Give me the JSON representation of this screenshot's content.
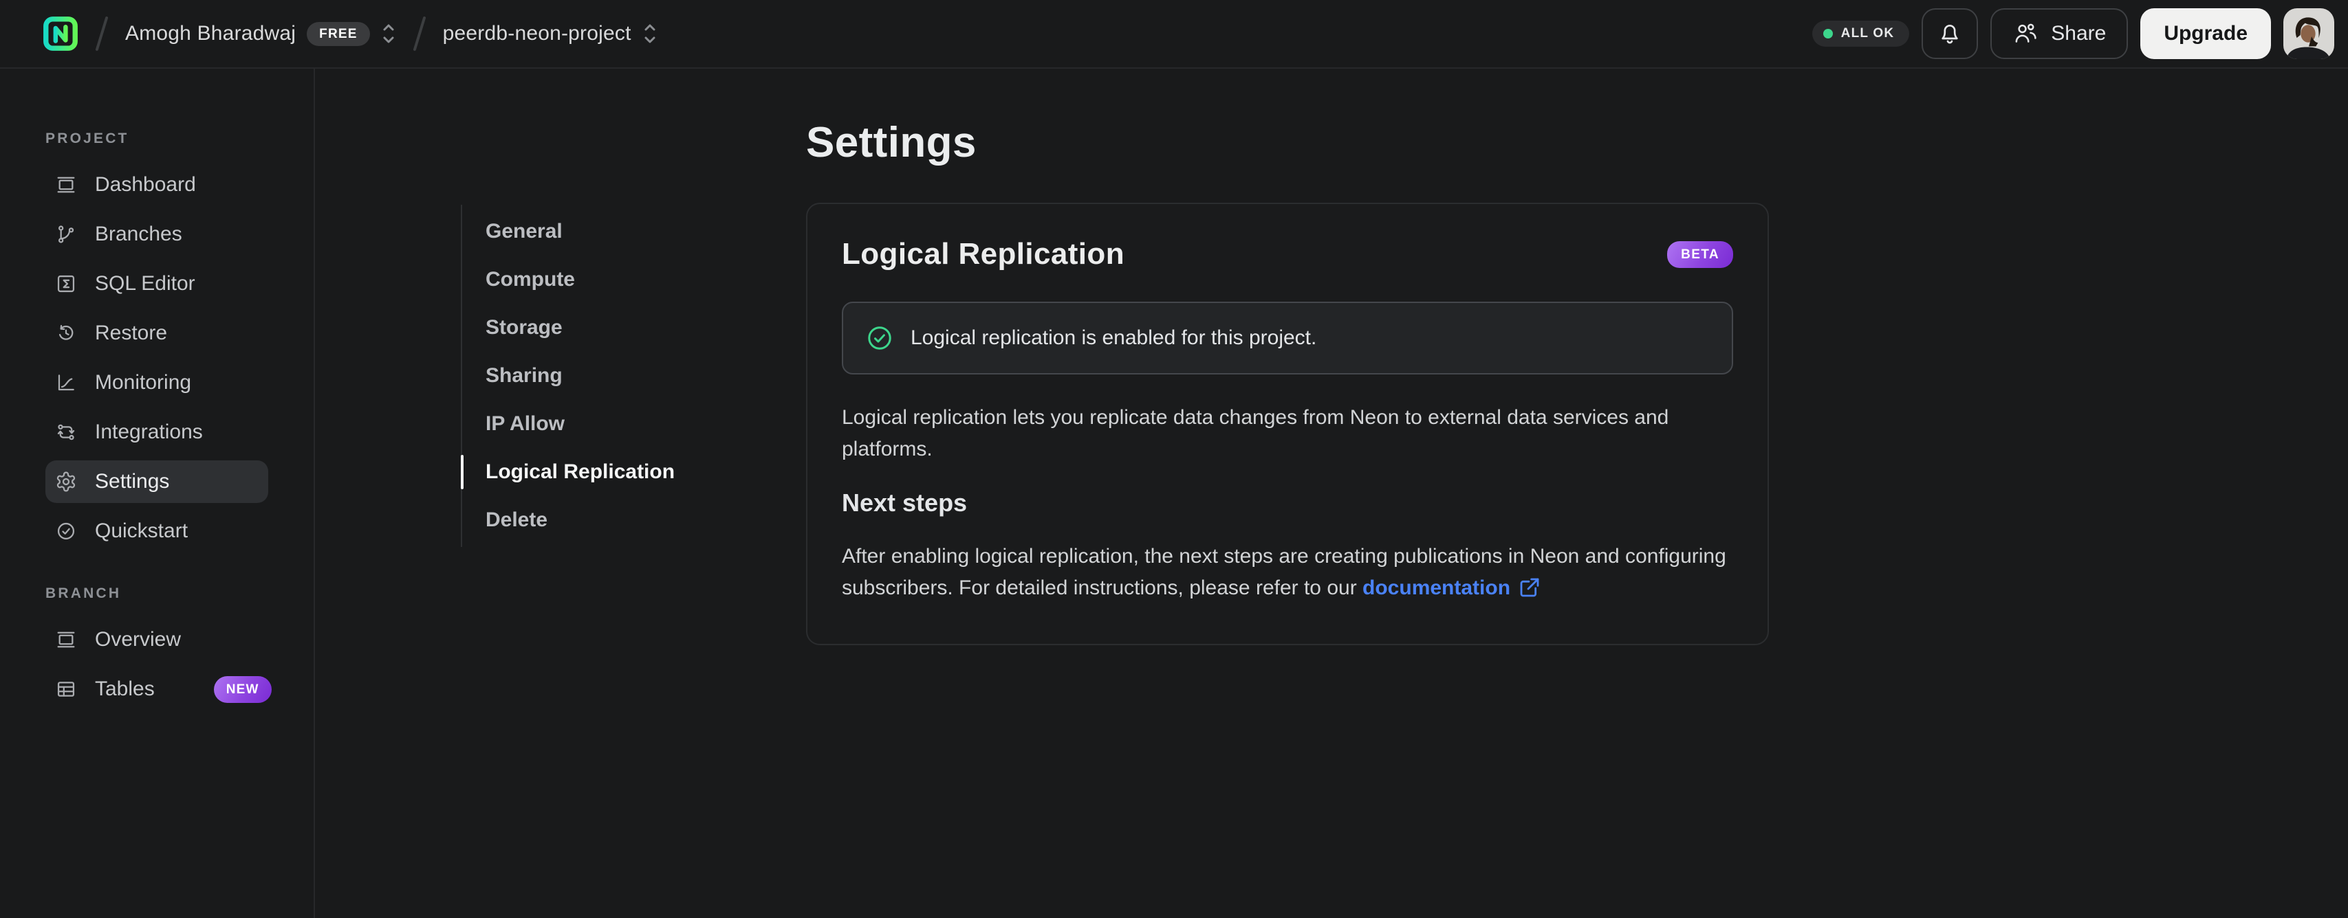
{
  "topbar": {
    "logo_icon": "neon-logo-icon",
    "org_name": "Amogh Bharadwaj",
    "plan_badge": "FREE",
    "project_name": "peerdb-neon-project",
    "status_label": "ALL OK",
    "status_dot_color": "#3dd68c",
    "bell_icon": "bell-icon",
    "share_label": "Share",
    "share_icon": "users-icon",
    "upgrade_label": "Upgrade"
  },
  "sidebar": {
    "sections": [
      {
        "label": "PROJECT",
        "items": [
          {
            "label": "Dashboard",
            "icon": "dashboard-icon"
          },
          {
            "label": "Branches",
            "icon": "git-branch-icon"
          },
          {
            "label": "SQL Editor",
            "icon": "sql-editor-icon"
          },
          {
            "label": "Restore",
            "icon": "restore-clock-icon"
          },
          {
            "label": "Monitoring",
            "icon": "monitoring-chart-icon"
          },
          {
            "label": "Integrations",
            "icon": "integrations-icon"
          },
          {
            "label": "Settings",
            "icon": "gear-icon",
            "active": true
          },
          {
            "label": "Quickstart",
            "icon": "check-circle-icon"
          }
        ]
      },
      {
        "label": "BRANCH",
        "items": [
          {
            "label": "Overview",
            "icon": "overview-icon"
          },
          {
            "label": "Tables",
            "icon": "table-icon",
            "badge": "NEW"
          }
        ]
      }
    ]
  },
  "settings": {
    "page_title": "Settings",
    "nav": [
      "General",
      "Compute",
      "Storage",
      "Sharing",
      "IP Allow",
      "Logical Replication",
      "Delete"
    ],
    "active_nav": "Logical Replication",
    "card": {
      "title": "Logical Replication",
      "badge": "BETA",
      "badge_color": "#8e45e0",
      "alert_icon": "check-circle-icon",
      "alert_icon_color": "#3dd68c",
      "alert_text": "Logical replication is enabled for this project.",
      "description": "Logical replication lets you replicate data changes from Neon to external data services and platforms.",
      "next_steps_title": "Next steps",
      "next_steps_text": "After enabling logical replication, the next steps are creating publications in Neon and configuring subscribers. For detailed instructions, please refer to our ",
      "link_text": "documentation",
      "link_color": "#4a82f7",
      "link_icon": "external-link-icon"
    }
  }
}
